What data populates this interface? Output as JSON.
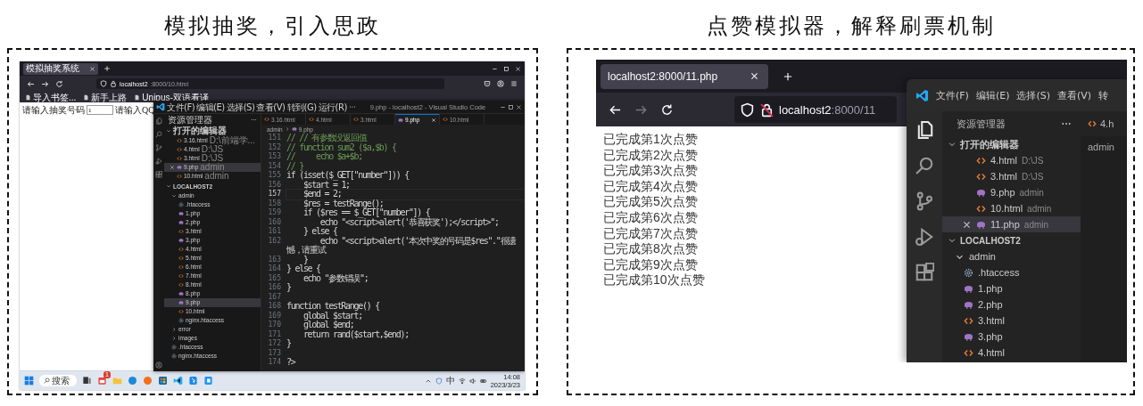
{
  "left_panel": {
    "caption": "模拟抽奖，引入思政",
    "browser": {
      "tab_title": "模拟抽奖系统",
      "url_host": "localhost2",
      "url_rest": ":8000/10.html",
      "bookmarks": [
        "导入书签...",
        "新手上路",
        "Unipus-双语看译"
      ],
      "form": {
        "label": "请输入抽奖号码",
        "value": "1",
        "label_2": "请输入QQ"
      }
    },
    "editor": {
      "menu": [
        "文件(F)",
        "编辑(E)",
        "选择(S)",
        "查看(V)",
        "转到(G)",
        "运行(R)"
      ],
      "window_title": "9.php - localhost2 - Visual Studio Code",
      "explorer_title": "资源管理器",
      "open_editors_title": "打开的编辑器",
      "open_editors": [
        {
          "name": "3.16.html",
          "description": "D:\\前端学...",
          "kind": "html",
          "selected": false
        },
        {
          "name": "4.html",
          "description": "D:\\JS",
          "kind": "html",
          "selected": false
        },
        {
          "name": "3.html",
          "description": "D:\\JS",
          "kind": "html",
          "selected": false
        },
        {
          "name": "9.php",
          "description": "admin",
          "kind": "php",
          "selected": true
        },
        {
          "name": "10.html",
          "description": "admin",
          "kind": "html",
          "selected": false
        }
      ],
      "folder_title": "LOCALHOST2",
      "tree": [
        {
          "name": "admin",
          "kind": "folder",
          "expanded": true,
          "selected": false,
          "children": [
            {
              "name": ".htaccess",
              "kind": "config",
              "selected": false
            },
            {
              "name": "1.php",
              "kind": "php",
              "selected": false
            },
            {
              "name": "2.php",
              "kind": "php",
              "selected": false
            },
            {
              "name": "3.html",
              "kind": "html",
              "selected": false
            },
            {
              "name": "3.php",
              "kind": "php",
              "selected": false
            },
            {
              "name": "4.html",
              "kind": "html",
              "selected": false
            },
            {
              "name": "5.html",
              "kind": "html",
              "selected": false
            },
            {
              "name": "6.html",
              "kind": "html",
              "selected": false
            },
            {
              "name": "7.html",
              "kind": "html",
              "selected": false
            },
            {
              "name": "8.html",
              "kind": "html",
              "selected": false
            },
            {
              "name": "8.php",
              "kind": "php",
              "selected": false
            },
            {
              "name": "9.php",
              "kind": "php",
              "selected": true
            },
            {
              "name": "10.html",
              "kind": "html",
              "selected": false
            },
            {
              "name": "nginx.htaccess",
              "kind": "config",
              "selected": false
            }
          ]
        },
        {
          "name": "error",
          "kind": "folder",
          "expanded": false,
          "selected": false
        },
        {
          "name": "images",
          "kind": "folder",
          "expanded": false,
          "selected": false
        },
        {
          "name": ".htaccess",
          "kind": "config",
          "selected": false
        },
        {
          "name": "nginx.htaccess",
          "kind": "config",
          "selected": false
        }
      ],
      "tabs": [
        {
          "label": "3.16.html",
          "kind": "html",
          "selected": false
        },
        {
          "label": "4.html",
          "kind": "html",
          "selected": false
        },
        {
          "label": "3.html",
          "kind": "html",
          "selected": false
        },
        {
          "label": "9.php",
          "kind": "php",
          "selected": true
        },
        {
          "label": "10.html",
          "kind": "html",
          "selected": false
        }
      ],
      "breadcrumb": [
        "admin",
        "9.php"
      ],
      "code_lines": [
        {
          "number": "151",
          "text": "// // 有参数没返回值",
          "kind": "comment",
          "current": false
        },
        {
          "number": "152",
          "text": "// function sum2 ($a,$b) {",
          "kind": "comment",
          "current": false
        },
        {
          "number": "153",
          "text": "//     echo $a+$b;",
          "kind": "comment",
          "current": false
        },
        {
          "number": "154",
          "text": "// }",
          "kind": "comment",
          "current": false
        },
        {
          "number": "155",
          "text": "if (isset($_GET[\"number\"])) {",
          "kind": "code",
          "current": false
        },
        {
          "number": "156",
          "text": "    $start = 1;",
          "kind": "code",
          "current": false
        },
        {
          "number": "157",
          "text": "    $end = 2;",
          "kind": "code",
          "current": true
        },
        {
          "number": "158",
          "text": "    $res = testRange();",
          "kind": "code",
          "current": false
        },
        {
          "number": "159",
          "text": "    if ($res == $_GET[\"number\"]) {",
          "kind": "code",
          "current": false
        },
        {
          "number": "160",
          "text": "        echo \"<script>alert('恭喜获奖');</script>\";",
          "kind": "code",
          "current": false
        },
        {
          "number": "161",
          "text": "    } else {",
          "kind": "code",
          "current": false
        },
        {
          "number": "162",
          "text": "        echo \"<script>alert('本次中奖的号码是$res\".\"很遗憾，请重试",
          "kind": "code",
          "current": false
        },
        {
          "number": "163",
          "text": "    }",
          "kind": "code",
          "current": false
        },
        {
          "number": "164",
          "text": "} else {",
          "kind": "code",
          "current": false
        },
        {
          "number": "165",
          "text": "    echo \"参数错误\";",
          "kind": "code",
          "current": false
        },
        {
          "number": "166",
          "text": "}",
          "kind": "code",
          "current": false
        },
        {
          "number": "167",
          "kind": "blank",
          "current": false
        },
        {
          "number": "168",
          "text": "function testRange() {",
          "kind": "code",
          "current": false
        },
        {
          "number": "169",
          "text": "    global $start;",
          "kind": "code",
          "current": false
        },
        {
          "number": "170",
          "text": "    global $end;",
          "kind": "code",
          "current": false
        },
        {
          "number": "171",
          "text": "    return rand($start,$end);",
          "kind": "code",
          "current": false
        },
        {
          "number": "172",
          "text": "}",
          "kind": "code",
          "current": false
        },
        {
          "number": "173",
          "kind": "blank",
          "current": false
        },
        {
          "number": "174",
          "text": "?>",
          "kind": "code",
          "current": false
        }
      ]
    },
    "taskbar": {
      "search_label": "搜索",
      "badge": "1",
      "language": "中",
      "time": "14:08",
      "date": "2023/3/23"
    }
  },
  "right_panel": {
    "caption": "点赞模拟器，解释刷票机制",
    "browser": {
      "tab_title": "localhost2:8000/11.php",
      "url_host": "localhost2",
      "url_rest": ":8000/11",
      "lines": [
        "已完成第1次点赞",
        "已完成第2次点赞",
        "已完成第3次点赞",
        "已完成第4次点赞",
        "已完成第5次点赞",
        "已完成第6次点赞",
        "已完成第7次点赞",
        "已完成第8次点赞",
        "已完成第9次点赞",
        "已完成第10次点赞"
      ]
    },
    "editor": {
      "menu": [
        "文件(F)",
        "编辑(E)",
        "选择(S)",
        "查看(V)",
        "转"
      ],
      "explorer_title": "资源管理器",
      "open_editors_title": "打开的编辑器",
      "open_editors": [
        {
          "name": "4.html",
          "description": "D:\\JS",
          "kind": "html",
          "selected": false
        },
        {
          "name": "3.html",
          "description": "D:\\JS",
          "kind": "html",
          "selected": false
        },
        {
          "name": "9.php",
          "description": "admin",
          "kind": "php",
          "selected": false
        },
        {
          "name": "10.html",
          "description": "admin",
          "kind": "html",
          "selected": false
        },
        {
          "name": "11.php",
          "description": "admin",
          "kind": "php",
          "selected": true
        }
      ],
      "folder_title": "LOCALHOST2",
      "tree": [
        {
          "name": "admin",
          "kind": "folder",
          "expanded": true,
          "children": [
            {
              "name": ".htaccess",
              "kind": "config"
            },
            {
              "name": "1.php",
              "kind": "php"
            },
            {
              "name": "2.php",
              "kind": "php"
            },
            {
              "name": "3.html",
              "kind": "html"
            },
            {
              "name": "3.php",
              "kind": "php"
            },
            {
              "name": "4.html",
              "kind": "html"
            }
          ]
        }
      ],
      "tab": {
        "label": "4.h",
        "kind": "html"
      },
      "breadcrumb": "admin"
    }
  }
}
